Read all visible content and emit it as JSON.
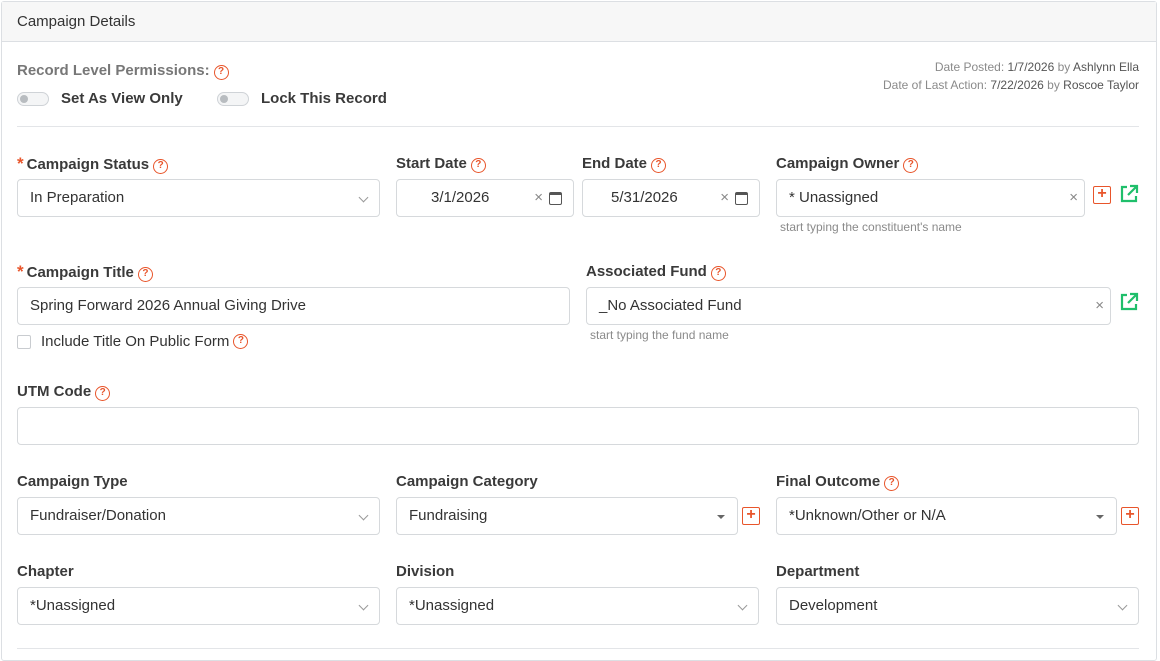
{
  "panel": {
    "title": "Campaign Details"
  },
  "permissions": {
    "label": "Record Level Permissions:",
    "toggles": [
      {
        "label": "Set As View Only",
        "on": false
      },
      {
        "label": "Lock This Record",
        "on": false
      }
    ]
  },
  "meta": {
    "posted_prefix": "Date Posted:",
    "posted_date": "1/7/2026",
    "posted_by_word": "by",
    "posted_by": "Ashlynn Ella",
    "action_prefix": "Date of Last Action:",
    "action_date": "7/22/2026",
    "action_by_word": "by",
    "action_by": "Roscoe Taylor"
  },
  "fields": {
    "campaign_status": {
      "label": "Campaign Status",
      "value": "In Preparation",
      "required": "*"
    },
    "start_date": {
      "label": "Start Date",
      "value": "3/1/2026"
    },
    "end_date": {
      "label": "End Date",
      "value": "5/31/2026"
    },
    "campaign_owner": {
      "label": "Campaign Owner",
      "value": "* Unassigned",
      "hint": "start typing the constituent's name"
    },
    "campaign_title": {
      "label": "Campaign Title",
      "value": "Spring Forward 2026 Annual Giving Drive",
      "required": "*"
    },
    "include_title": {
      "label": "Include Title On Public Form",
      "checked": false
    },
    "associated_fund": {
      "label": "Associated Fund",
      "value": "_No Associated Fund",
      "hint": "start typing the fund name"
    },
    "utm_code": {
      "label": "UTM Code",
      "value": ""
    },
    "campaign_type": {
      "label": "Campaign Type",
      "value": "Fundraiser/Donation"
    },
    "campaign_category": {
      "label": "Campaign Category",
      "value": "Fundraising"
    },
    "final_outcome": {
      "label": "Final Outcome",
      "value": "*Unknown/Other or N/A"
    },
    "chapter": {
      "label": "Chapter",
      "value": "*Unassigned"
    },
    "division": {
      "label": "Division",
      "value": "*Unassigned"
    },
    "department": {
      "label": "Department",
      "value": "Development"
    }
  },
  "icons": {
    "help": "question-circle-icon",
    "add": "plus-square-icon",
    "external": "external-link-icon",
    "calendar": "calendar-icon",
    "clear": "close-icon"
  },
  "glyphs": {
    "help": "?",
    "plus": "+",
    "clear": "×"
  },
  "colors": {
    "accent": "#e8552b",
    "link_green": "#1fbf6b"
  }
}
